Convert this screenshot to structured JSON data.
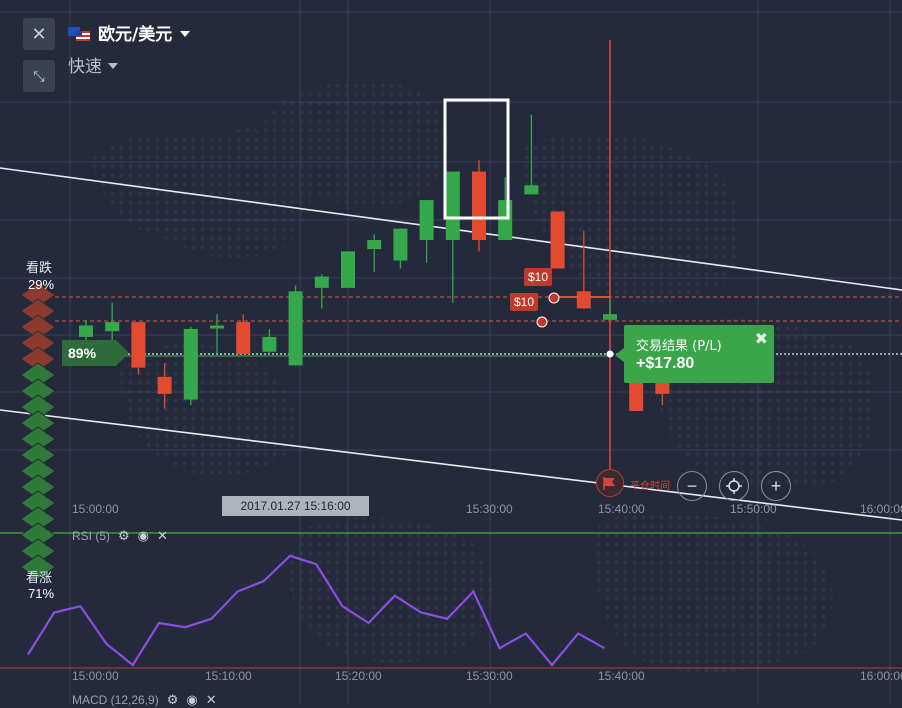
{
  "header": {
    "pair_label": "欧元/美元",
    "mode_label": "快速",
    "close_icon": "close-icon",
    "collapse_icon": "collapse-arrows-icon"
  },
  "sentiment": {
    "put_label": "看跌",
    "put_pct": "29%",
    "call_label": "看涨",
    "call_pct": "71%"
  },
  "payout": {
    "label": "89%"
  },
  "bets": [
    {
      "label": "$10"
    },
    {
      "label": "$10"
    }
  ],
  "result": {
    "title": "交易结果 (P/L)",
    "value": "+$17.80"
  },
  "time_axis": {
    "main_ticks": [
      "15:00:00",
      "15:30:00",
      "15:40:00",
      "15:50:00",
      "16:00:00"
    ],
    "hover_date": "2017.01.27 15:16:00",
    "lower_ticks": [
      "15:00:00",
      "15:10:00",
      "15:20:00",
      "15:30:00",
      "15:40:00",
      "16:00:00"
    ]
  },
  "expiry": {
    "label": "平仓时间"
  },
  "controls": {
    "zoom_out": "−",
    "zoom_in": "+"
  },
  "indicators": {
    "rsi": "RSI (5)",
    "macd": "MACD (12,26,9)"
  },
  "colors": {
    "up": "#34a84a",
    "down": "#e34b31",
    "rsi_line": "#8a4fe0",
    "background": "#242a3b"
  },
  "chart_data": {
    "type": "candlestick",
    "candles": [
      {
        "o": 15,
        "h": 30,
        "l": 8,
        "c": 25
      },
      {
        "o": 20,
        "h": 45,
        "l": 12,
        "c": 28
      },
      {
        "o": 28,
        "h": 28,
        "l": -18,
        "c": -12
      },
      {
        "o": -20,
        "h": -8,
        "l": -48,
        "c": -35
      },
      {
        "o": -40,
        "h": 24,
        "l": -45,
        "c": 22
      },
      {
        "o": 25,
        "h": 35,
        "l": 0,
        "c": 25
      },
      {
        "o": 28,
        "h": 35,
        "l": 0,
        "c": 0
      },
      {
        "o": 2,
        "h": 22,
        "l": 0,
        "c": 15
      },
      {
        "o": -10,
        "h": 60,
        "l": -10,
        "c": 55
      },
      {
        "o": 58,
        "h": 70,
        "l": 40,
        "c": 68
      },
      {
        "o": 58,
        "h": 78,
        "l": 58,
        "c": 90
      },
      {
        "o": 92,
        "h": 105,
        "l": 72,
        "c": 100
      },
      {
        "o": 82,
        "h": 110,
        "l": 75,
        "c": 110
      },
      {
        "o": 100,
        "h": 125,
        "l": 80,
        "c": 135
      },
      {
        "o": 100,
        "h": 160,
        "l": 45,
        "c": 160
      },
      {
        "o": 160,
        "h": 170,
        "l": 90,
        "c": 100
      },
      {
        "o": 100,
        "h": 155,
        "l": 100,
        "c": 135
      },
      {
        "o": 140,
        "h": 210,
        "l": 140,
        "c": 148
      },
      {
        "o": 125,
        "h": 125,
        "l": 75,
        "c": 75
      },
      {
        "o": 55,
        "h": 108,
        "l": 40,
        "c": 40
      },
      {
        "o": 30,
        "h": 48,
        "l": 30,
        "c": 35
      },
      {
        "o": 25,
        "h": 25,
        "l": -30,
        "c": -50
      },
      {
        "o": -20,
        "h": -10,
        "l": -45,
        "c": -35
      }
    ],
    "rsi": [
      5,
      25,
      28,
      10,
      0,
      20,
      18,
      22,
      35,
      40,
      52,
      48,
      28,
      20,
      33,
      25,
      22,
      35,
      8,
      15,
      0,
      15,
      8
    ]
  }
}
